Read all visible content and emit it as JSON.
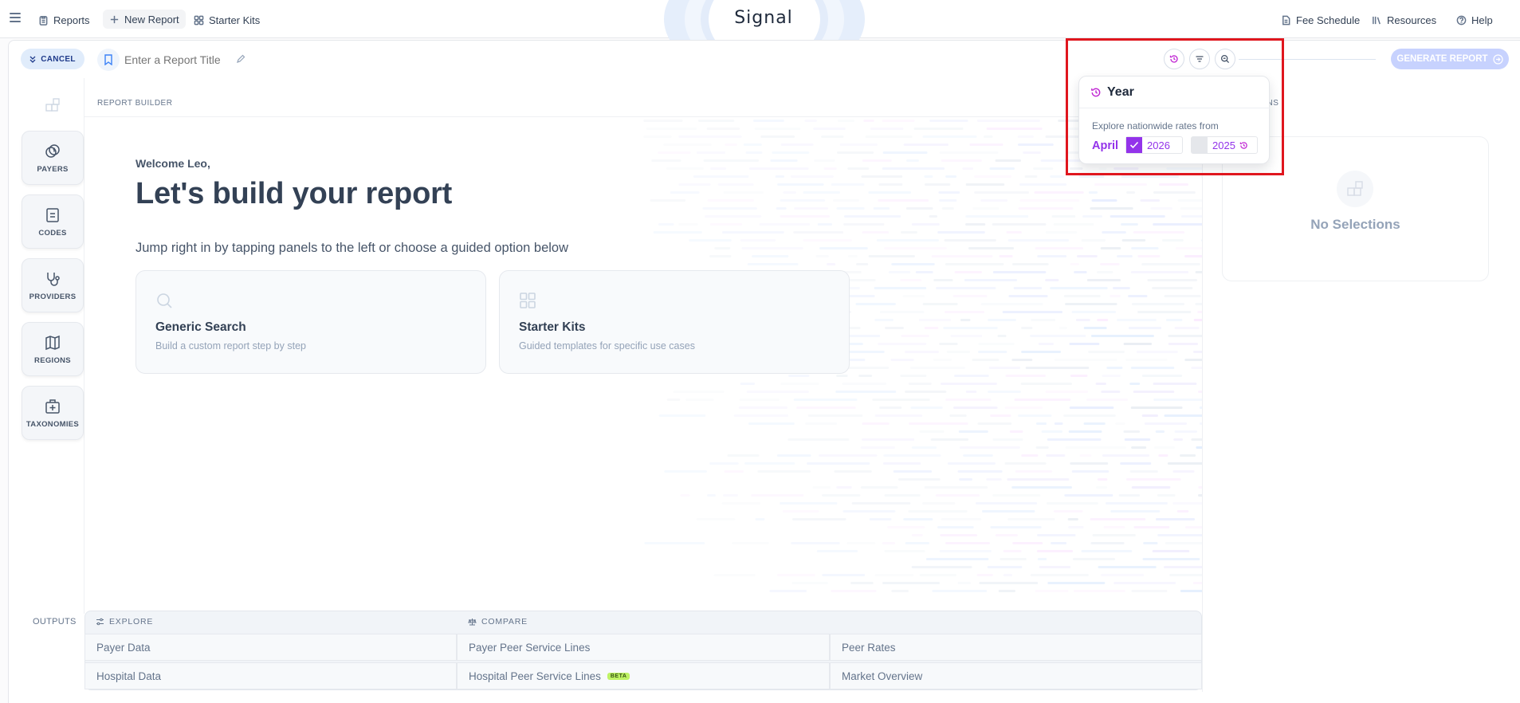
{
  "nav": {
    "reports": "Reports",
    "new_report": "New Report",
    "starter_kits": "Starter Kits",
    "brand": "Signal",
    "fee_schedule": "Fee Schedule",
    "resources": "Resources",
    "help": "Help"
  },
  "toolbar": {
    "cancel": "CANCEL",
    "title_placeholder": "Enter a Report Title",
    "generate": "GENERATE REPORT"
  },
  "sidebar": {
    "items": [
      {
        "label": "PAYERS",
        "icon": "coins-icon"
      },
      {
        "label": "CODES",
        "icon": "file-icon"
      },
      {
        "label": "PROVIDERS",
        "icon": "stethoscope-icon"
      },
      {
        "label": "REGIONS",
        "icon": "map-icon"
      },
      {
        "label": "TAXONOMIES",
        "icon": "medical-kit-icon"
      }
    ]
  },
  "builder": {
    "section_label": "REPORT BUILDER",
    "welcome": "Welcome Leo,",
    "headline": "Let's build your report",
    "subline": "Jump right in by tapping panels to the left or choose a guided option below",
    "cards": [
      {
        "title": "Generic Search",
        "desc": "Build a custom report step by step",
        "icon": "search-icon"
      },
      {
        "title": "Starter Kits",
        "desc": "Guided templates for specific use cases",
        "icon": "grid-icon"
      }
    ]
  },
  "selections": {
    "label_partial": "IONS",
    "empty": "No Selections"
  },
  "outputs": {
    "label": "OUTPUTS",
    "explore": "EXPLORE",
    "compare": "COMPARE",
    "cells": {
      "payer_data": "Payer Data",
      "hospital_data": "Hospital Data",
      "payer_peer": "Payer Peer Service Lines",
      "hospital_peer": "Hospital Peer Service Lines",
      "beta": "BETA",
      "peer_rates": "Peer Rates",
      "market_overview": "Market Overview"
    }
  },
  "year_popover": {
    "title": "Year",
    "desc": "Explore nationwide rates from",
    "month": "April",
    "options": [
      {
        "year": "2026",
        "checked": true
      },
      {
        "year": "2025",
        "checked": false
      }
    ]
  },
  "colors": {
    "accent_purple": "#9333ea",
    "highlight_red": "#e0161e",
    "generate_bg": "#c7d2fe"
  }
}
